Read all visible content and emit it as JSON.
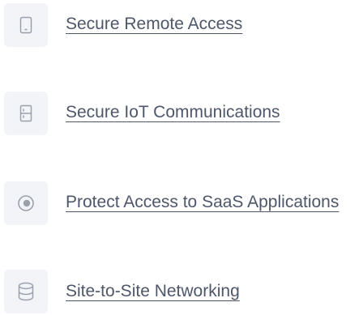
{
  "items": [
    {
      "label": "Secure Remote Access",
      "icon": "mobile-device-icon"
    },
    {
      "label": "Secure IoT Communications",
      "icon": "iot-device-icon"
    },
    {
      "label": "Protect Access to SaaS Applications",
      "icon": "target-circle-icon"
    },
    {
      "label": "Site-to-Site Networking",
      "icon": "database-icon"
    }
  ],
  "colors": {
    "text": "#4e5769",
    "icon_bg": "#f3f4f7",
    "icon_stroke": "#9aa1ad"
  }
}
